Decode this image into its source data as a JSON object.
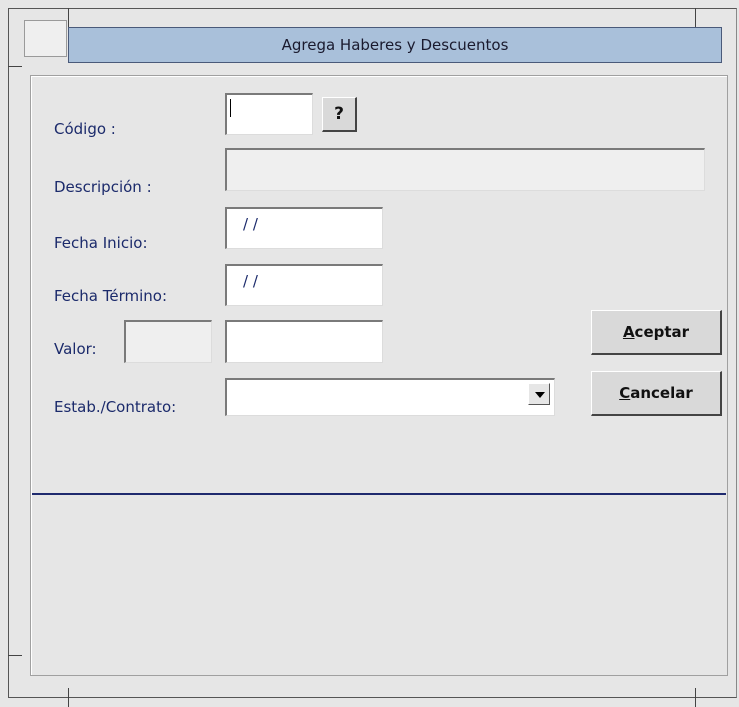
{
  "window": {
    "title": "Agrega Haberes y Descuentos"
  },
  "form": {
    "codigo": {
      "label": "Código :",
      "value": ""
    },
    "lookup_label": "?",
    "descripcion": {
      "label": "Descripción :",
      "value": ""
    },
    "fecha_inicio": {
      "label": "Fecha Inicio:",
      "value": "/ /"
    },
    "fecha_termino": {
      "label": "Fecha Término:",
      "value": "/ /"
    },
    "valor": {
      "label": "Valor:",
      "value1": "",
      "value2": ""
    },
    "estab_contrato": {
      "label": "Estab./Contrato:",
      "selected": ""
    }
  },
  "buttons": {
    "aceptar": {
      "mnemonic": "A",
      "rest": "ceptar"
    },
    "cancelar": {
      "mnemonic": "C",
      "rest": "ancelar"
    }
  },
  "icons": {
    "dropdown": "chevron-down-icon"
  }
}
